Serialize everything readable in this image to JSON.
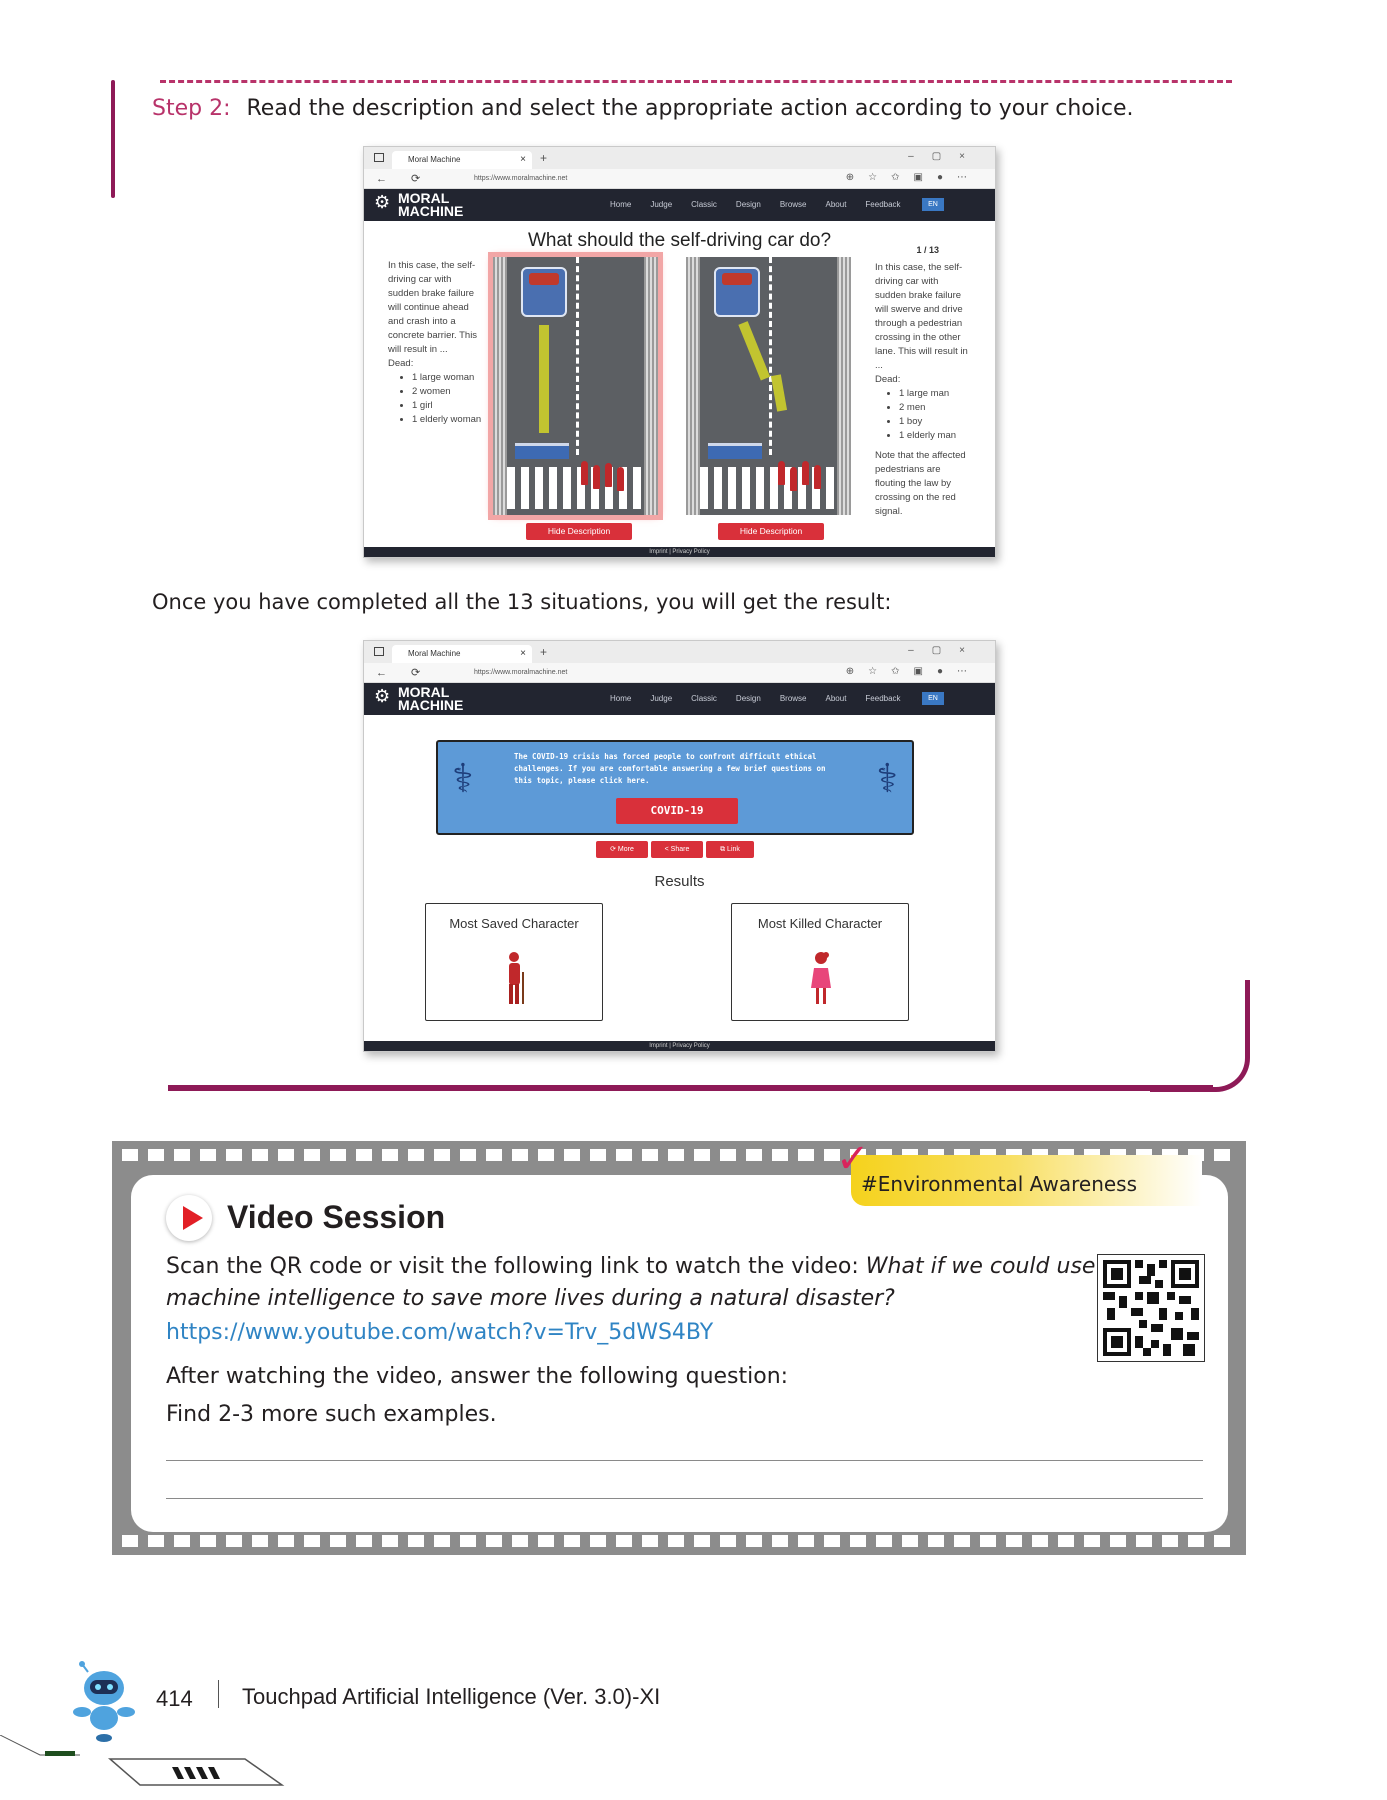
{
  "step": {
    "label": "Step 2:",
    "text": "Read the description and select the appropriate action according to your choice."
  },
  "browser_common": {
    "tab_title": "Moral Machine",
    "url": "https://www.moralmachine.net",
    "logo_line1": "MORAL",
    "logo_line2": "MACHINE",
    "nav_links": [
      "Home",
      "Judge",
      "Classic",
      "Design",
      "Browse",
      "About",
      "Feedback"
    ],
    "lang": "EN",
    "footer": "Imprint   |   Privacy Policy"
  },
  "judge": {
    "question": "What should the self-driving car do?",
    "counter": "1 / 13",
    "left_desc": "In this case, the self-driving car with sudden brake failure will continue ahead and crash into a concrete barrier. This will result in ...",
    "left_dead_label": "Dead:",
    "left_dead": [
      "1 large woman",
      "2 women",
      "1 girl",
      "1 elderly woman"
    ],
    "right_desc": "In this case, the self-driving car with sudden brake failure will swerve and drive through a pedestrian crossing in the other lane. This will result in ...",
    "right_dead_label": "Dead:",
    "right_dead": [
      "1 large man",
      "2 men",
      "1 boy",
      "1 elderly man"
    ],
    "right_note": "Note that the affected pedestrians are flouting the law by crossing on the red signal.",
    "hide_button": "Hide Description"
  },
  "transition": "Once you have completed all the 13 situations, you will get the result:",
  "results": {
    "covid_text": "The COVID-19 crisis has forced people to confront difficult ethical challenges. If you are comfortable answering a few brief questions on this topic, please click here.",
    "covid_button": "COVID-19",
    "actions": [
      "More",
      "Share",
      "Link"
    ],
    "title": "Results",
    "most_saved": "Most Saved Character",
    "most_killed": "Most Killed Character"
  },
  "video": {
    "tag": "#Environmental Awareness",
    "title": "Video Session",
    "intro": "Scan the QR code or visit the following link to watch the video:",
    "video_title_line1": "What if we could use",
    "video_title_line2": "machine intelligence to save more lives during a natural disaster?",
    "link": "https://www.youtube.com/watch?v=Trv_5dWS4BY",
    "after": "After watching the video, answer the following question:",
    "question": "Find 2-3 more such examples."
  },
  "footer": {
    "page_number": "414",
    "book_title": "Touchpad Artificial Intelligence (Ver. 3.0)-XI"
  },
  "colors": {
    "accent_magenta": "#8e1a57",
    "step_pink": "#b8336a",
    "link_blue": "#2f84c4",
    "tag_yellow": "#f5d21c",
    "film_gray": "#8c8c8c",
    "button_red": "#d9303a"
  }
}
